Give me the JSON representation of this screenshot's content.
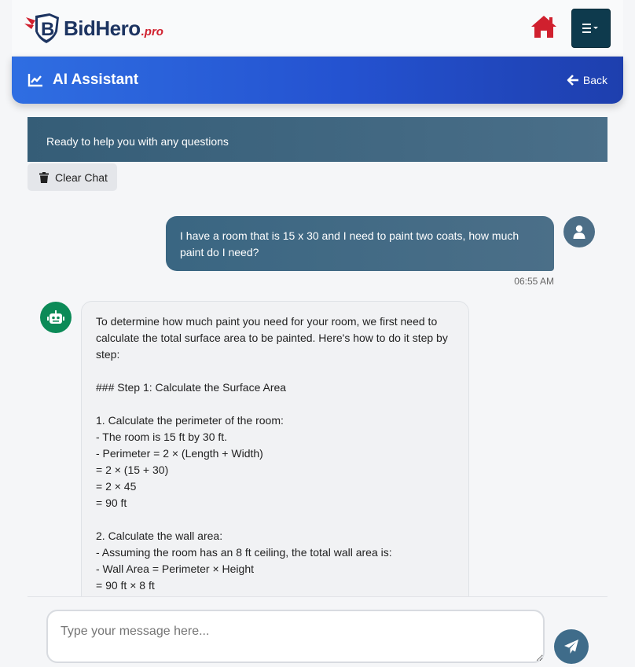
{
  "nav": {
    "logo_text": "BidHero",
    "logo_suffix": ".pro",
    "home_icon": "home-icon",
    "menu_icon": "hamburger-menu-icon"
  },
  "header": {
    "title": "AI Assistant",
    "back_label": "Back"
  },
  "status": {
    "text": "Ready to help you with any questions"
  },
  "toolbar": {
    "clear_label": "Clear Chat"
  },
  "chat": {
    "messages": [
      {
        "role": "user",
        "text": "I have a room that is 15 x 30 and I need to paint two coats, how much paint do I need?",
        "time": "06:55 AM"
      },
      {
        "role": "assistant",
        "lines": [
          "To determine how much paint you need for your room, we first need to calculate the total surface area to be painted. Here's how to do it step by step:",
          "",
          "### Step 1: Calculate the Surface Area",
          "",
          "1. Calculate the perimeter of the room:",
          "- The room is 15 ft by 30 ft.",
          "- Perimeter = 2 × (Length + Width)",
          "= 2 × (15 + 30)",
          "= 2 × 45",
          "= 90 ft",
          "",
          "2. Calculate the wall area:",
          "- Assuming the room has an 8 ft ceiling, the total wall area is:",
          "- Wall Area = Perimeter × Height",
          "= 90 ft × 8 ft"
        ]
      }
    ]
  },
  "composer": {
    "placeholder": "Type your message here..."
  },
  "colors": {
    "header_gradient_start": "#2f6ee2",
    "header_gradient_end": "#1e3fae",
    "brand_red": "#d0202e",
    "brand_navy": "#1d3461",
    "menu_button": "#0e3a4d",
    "bot_avatar": "#0b8a57"
  }
}
